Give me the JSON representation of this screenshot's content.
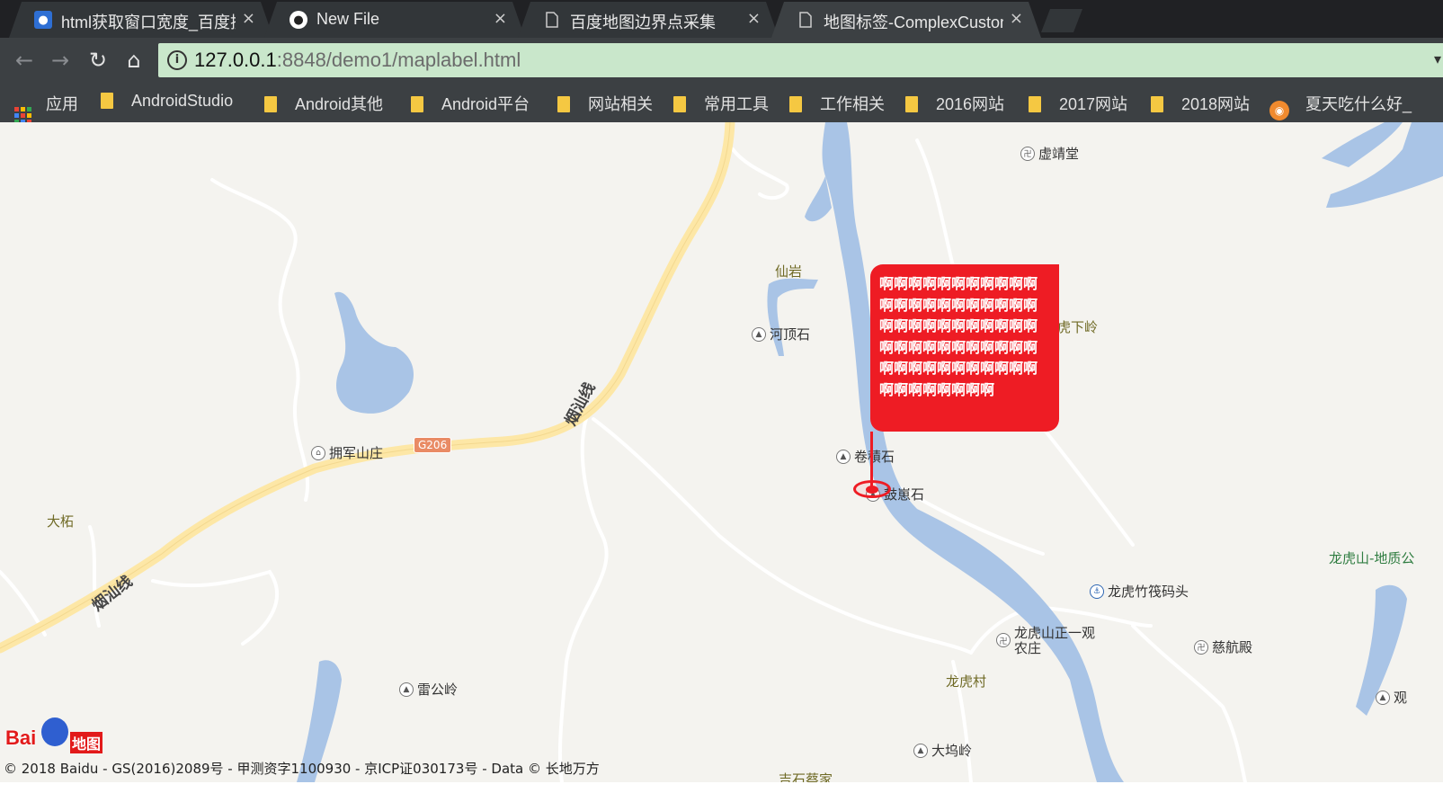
{
  "tabs": [
    {
      "title": "html获取窗口宽度_百度搜",
      "icon": "baidu-paw-icon",
      "active": false
    },
    {
      "title": "New File",
      "icon": "github-icon",
      "active": false
    },
    {
      "title": "百度地图边界点采集",
      "icon": "document-icon",
      "active": false
    },
    {
      "title": "地图标签-ComplexCustom",
      "icon": "document-icon",
      "active": true
    }
  ],
  "tab_close": "×",
  "toolbar": {
    "url_host": "127.0.0.1",
    "url_rest": ":8848/demo1/maplabel.html",
    "info_glyph": "i"
  },
  "bookmarks": [
    {
      "label": "应用",
      "type": "apps"
    },
    {
      "label": "AndroidStudio",
      "type": "folder"
    },
    {
      "label": "Android其他",
      "type": "folder"
    },
    {
      "label": "Android平台",
      "type": "folder"
    },
    {
      "label": "网站相关",
      "type": "folder"
    },
    {
      "label": "常用工具",
      "type": "folder"
    },
    {
      "label": "工作相关",
      "type": "folder"
    },
    {
      "label": "2016网站",
      "type": "folder"
    },
    {
      "label": "2017网站",
      "type": "folder"
    },
    {
      "label": "2018网站",
      "type": "folder"
    },
    {
      "label": "夏天吃什么好_",
      "type": "site"
    }
  ],
  "map": {
    "label_text": "啊啊啊啊啊啊啊啊啊啊啊啊啊啊啊啊啊啊啊啊啊啊啊啊啊啊啊啊啊啊啊啊啊啊啊啊啊啊啊啊啊啊啊啊啊啊啊啊啊啊啊啊啊啊啊啊啊啊啊啊啊啊啊",
    "pois": [
      "虚靖堂",
      "河顶石",
      "卷積石",
      "鼓崽石",
      "拥军山庄",
      "龙虎竹筏码头",
      "龙虎山正一观",
      "农庄",
      "慈航殿",
      "雷公岭",
      "大坞岭",
      "观"
    ],
    "places": [
      "仙岩",
      "虎下岭",
      "大柘",
      "龙虎村",
      "龙虎山-地质公",
      "吉石蔡家"
    ],
    "roads": [
      "烟汕线",
      "烟汕线"
    ],
    "shield": "G206",
    "logo_text": "Bai",
    "logo_text2": "地图",
    "copyright": "© 2018 Baidu - GS(2016)2089号 - 甲测资字1100930 - 京ICP证030173号 - Data © 长地万方"
  },
  "colors": {
    "accent": "#ee1c24",
    "water": "#a9c4e6",
    "road": "#fde7a6",
    "omnibox": "#c9e7cb"
  }
}
